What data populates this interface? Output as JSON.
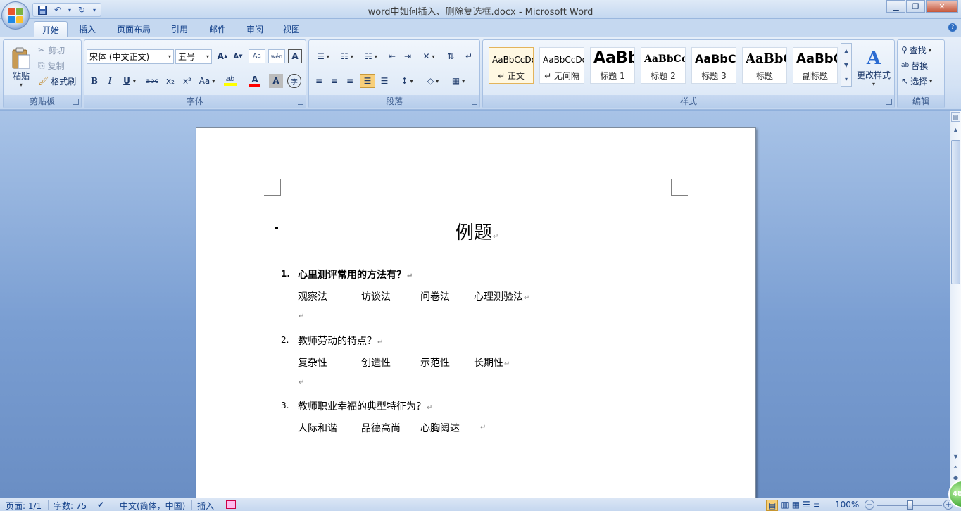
{
  "window": {
    "title": "word中如何插入、删除复选框.docx - Microsoft Word"
  },
  "tabs": [
    "开始",
    "插入",
    "页面布局",
    "引用",
    "邮件",
    "审阅",
    "视图"
  ],
  "clipboard": {
    "paste": "粘贴",
    "cut": "剪切",
    "copy": "复制",
    "format_painter": "格式刷",
    "label": "剪贴板"
  },
  "font": {
    "name": "宋体 (中文正文)",
    "size": "五号",
    "label": "字体",
    "bold": "B",
    "italic": "I",
    "underline": "U",
    "strike": "abc",
    "sub": "x₂",
    "sup": "x²",
    "case": "Aa",
    "highlight": "ab",
    "color": "A",
    "charshade": "A",
    "enclose": "字",
    "grow": "A",
    "shrink": "A",
    "clear": "Aa",
    "phonetic": "wén",
    "border": "A"
  },
  "paragraph": {
    "label": "段落"
  },
  "styles": {
    "label": "样式",
    "change": "更改样式",
    "items": [
      {
        "sample": "AaBbCcDd",
        "name": "↵ 正文"
      },
      {
        "sample": "AaBbCcDd",
        "name": "↵ 无间隔"
      },
      {
        "sample": "AaBb",
        "name": "标题 1"
      },
      {
        "sample": "AaBbCcI",
        "name": "标题 2"
      },
      {
        "sample": "AaBbC",
        "name": "标题 3"
      },
      {
        "sample": "AaBbC",
        "name": "标题"
      },
      {
        "sample": "AaBbC",
        "name": "副标题"
      }
    ]
  },
  "editing": {
    "find": "查找",
    "replace": "替换",
    "select": "选择",
    "label": "编辑"
  },
  "document": {
    "title": "例题",
    "questions": [
      {
        "num": "1.",
        "text": "心里测评常用的方法有？",
        "options": [
          "观察法",
          "访谈法",
          "问卷法",
          "心理测验法"
        ]
      },
      {
        "num": "2.",
        "text": "教师劳动的特点？",
        "options": [
          "复杂性",
          "创造性",
          "示范性",
          "长期性"
        ]
      },
      {
        "num": "3.",
        "text": "教师职业幸福的典型特征为？",
        "options": [
          "人际和谐",
          "品德高尚",
          "心胸阔达"
        ]
      }
    ],
    "para_mark": "↵"
  },
  "status": {
    "page": "页面: 1/1",
    "words": "字数: 75",
    "language": "中文(简体，中国)",
    "mode": "插入",
    "zoom": "100%",
    "zoom_minus": "−",
    "zoom_plus": "+",
    "badge": "48"
  },
  "colors": {
    "accent": "#15428b",
    "ribbon": "#d2e1f4",
    "doc_bg": "#7a9ed2",
    "highlight": "#ffff00",
    "font_color": "#ff0000"
  }
}
